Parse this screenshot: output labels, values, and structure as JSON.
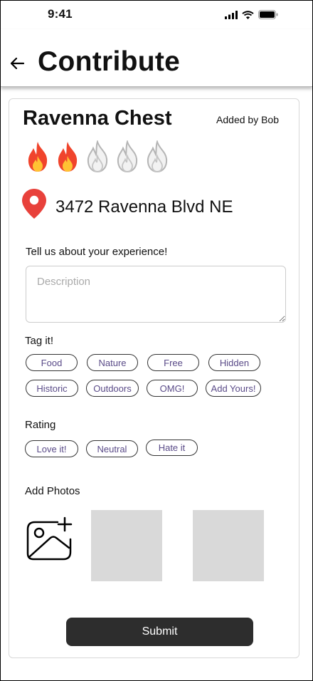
{
  "status": {
    "time": "9:41"
  },
  "header": {
    "title": "Contribute"
  },
  "place": {
    "name": "Ravenna Chest",
    "added_by": "Added by Bob",
    "heat_rating": 2,
    "heat_max": 5,
    "address": "3472 Ravenna Blvd NE"
  },
  "experience": {
    "label": "Tell us about your experience!",
    "placeholder": "Description",
    "value": ""
  },
  "tags": {
    "label": "Tag it!",
    "items": [
      "Food",
      "Nature",
      "Free",
      "Hidden",
      "Historic",
      "Outdoors",
      "OMG!",
      "Add Yours!"
    ]
  },
  "rating": {
    "label": "Rating",
    "options": [
      "Love it!",
      "Neutral",
      "Hate it"
    ]
  },
  "photos": {
    "label": "Add Photos"
  },
  "submit": {
    "label": "Submit"
  },
  "colors": {
    "chip_text": "#5a4b88",
    "submit_bg": "#2d2d2d",
    "pin": "#e8413b",
    "photo_placeholder": "#d9d9d9"
  }
}
